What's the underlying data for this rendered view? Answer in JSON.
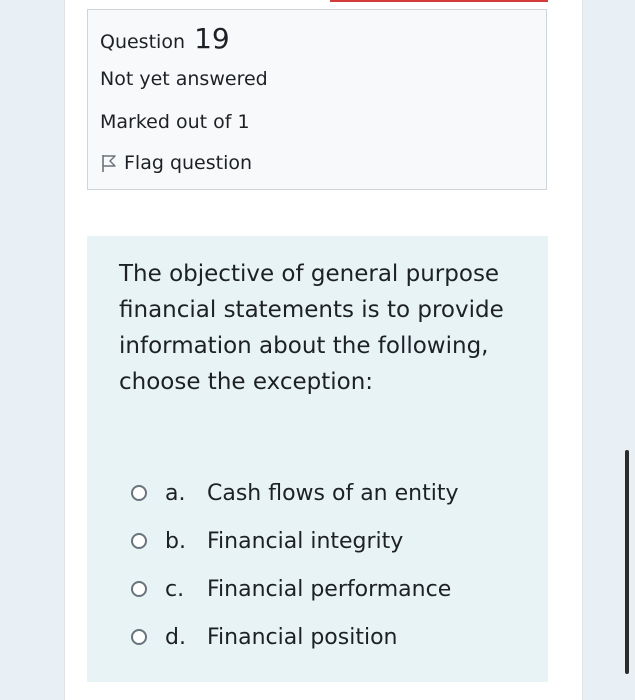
{
  "question": {
    "label": "Question",
    "number": "19",
    "state": "Not yet answered",
    "mark": "Marked out of 1",
    "flag_label": "Flag question",
    "text": "The objective of general purpose financial statements is to provide information about the following, choose the exception:",
    "answers": [
      {
        "letter": "a.",
        "text": "Cash flows of an entity"
      },
      {
        "letter": "b.",
        "text": "Financial integrity"
      },
      {
        "letter": "c.",
        "text": "Financial performance"
      },
      {
        "letter": "d.",
        "text": "Financial position"
      }
    ]
  },
  "icons": {
    "flag": "flag-icon",
    "radio": "radio-unchecked-icon"
  },
  "colors": {
    "info_bg": "#f8f9fa",
    "content_bg": "#e7f3f5",
    "side_bg": "#e9f0f5",
    "accent_red": "#d43c3c"
  }
}
